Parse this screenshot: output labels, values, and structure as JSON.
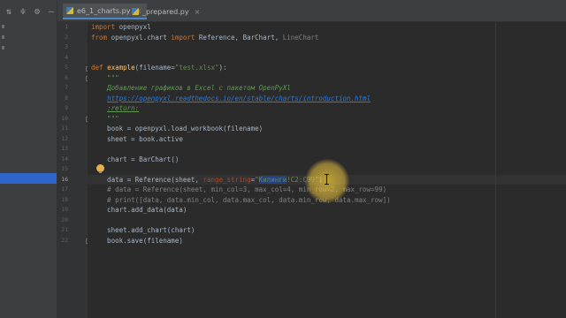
{
  "tabs": [
    {
      "label": "e6_1_charts.py",
      "active": true
    },
    {
      "label": "_prepared.py",
      "active": false
    }
  ],
  "sidebar": {
    "icons": [
      "collapse-all-icon",
      "expand-icon",
      "gear-icon",
      "minimize-icon"
    ]
  },
  "editor": {
    "current_line": 16,
    "lines": [
      {
        "n": "1",
        "code": "import openpyxl"
      },
      {
        "n": "2",
        "code": "from openpyxl.chart import Reference, BarChart, LineChart"
      },
      {
        "n": "3",
        "code": ""
      },
      {
        "n": "4",
        "code": ""
      },
      {
        "n": "5",
        "code": "def example(filename=\"test.xlsx\"):"
      },
      {
        "n": "6",
        "code": "    \"\"\""
      },
      {
        "n": "7",
        "code": "    Добавление графиков в Excel с пакетом OpenPyXl"
      },
      {
        "n": "8",
        "code": "    https://openpyxl.readthedocs.io/en/stable/charts/introduction.html"
      },
      {
        "n": "9",
        "code": "    :return:"
      },
      {
        "n": "10",
        "code": "    \"\"\""
      },
      {
        "n": "11",
        "code": "    book = openpyxl.load_workbook(filename)"
      },
      {
        "n": "12",
        "code": "    sheet = book.active"
      },
      {
        "n": "13",
        "code": ""
      },
      {
        "n": "14",
        "code": "    chart = BarChart()"
      },
      {
        "n": "15",
        "code": ""
      },
      {
        "n": "16",
        "code": "    data = Reference(sheet, range_string=\"Килинги!C2:C99\")"
      },
      {
        "n": "17",
        "code": "    # data = Reference(sheet, min_col=3, max_col=4, min_row=2, max_row=99)"
      },
      {
        "n": "18",
        "code": "    # print([data, data.min_col, data.max_col, data.min_row, data.max_row])"
      },
      {
        "n": "19",
        "code": "    chart.add_data(data)"
      },
      {
        "n": "20",
        "code": ""
      },
      {
        "n": "21",
        "code": "    sheet.add_chart(chart)"
      },
      {
        "n": "22",
        "code": "    book.save(filename)"
      }
    ],
    "tokens": {
      "l1_kw": "import",
      "l1_rest": " openpyxl",
      "l2_kw1": "from",
      "l2_mid": " openpyxl.chart ",
      "l2_kw2": "import",
      "l2_rest": " Reference, BarChart, ",
      "l2_grey": "LineChart",
      "l5_kw": "def ",
      "l5_fn": "example",
      "l5_a": "(filename=",
      "l5_str": "\"test.xlsx\"",
      "l5_b": "):",
      "l6": "    \"\"\"",
      "l7": "    Добавление графиков в Excel с пакетом OpenPyXl",
      "l8_pre": "    ",
      "l8_link": "https://openpyxl.readthedocs.io/en/stable/charts/introduction.html",
      "l9_pre": "    ",
      "l9_tag": ":return:",
      "l10": "    \"\"\"",
      "l11": "    book = openpyxl.load_workbook(filename)",
      "l12": "    sheet = book.active",
      "l14": "    chart = BarChart()",
      "l16_a": "    data = Reference(sheet, ",
      "l16_param": "range_string",
      "l16_eq": "=",
      "l16_q": "\"",
      "l16_sel": "Килинги",
      "l16_rest": "!C2:C99\"",
      "l16_end": ")",
      "l17": "    # data = Reference(sheet, min_col=3, max_col=4, min_row=2, max_row=99)",
      "l18": "    # print([data, data.min_col, data.max_col, data.min_row, data.max_row])",
      "l19": "    chart.add_data(data)",
      "l21": "    sheet.add_chart(chart)",
      "l22": "    book.save(filename)"
    }
  },
  "colors": {
    "background": "#2b2b2b",
    "keyword": "#cc7832",
    "string": "#6a8759",
    "function": "#ffc66d",
    "selection": "#214283"
  }
}
